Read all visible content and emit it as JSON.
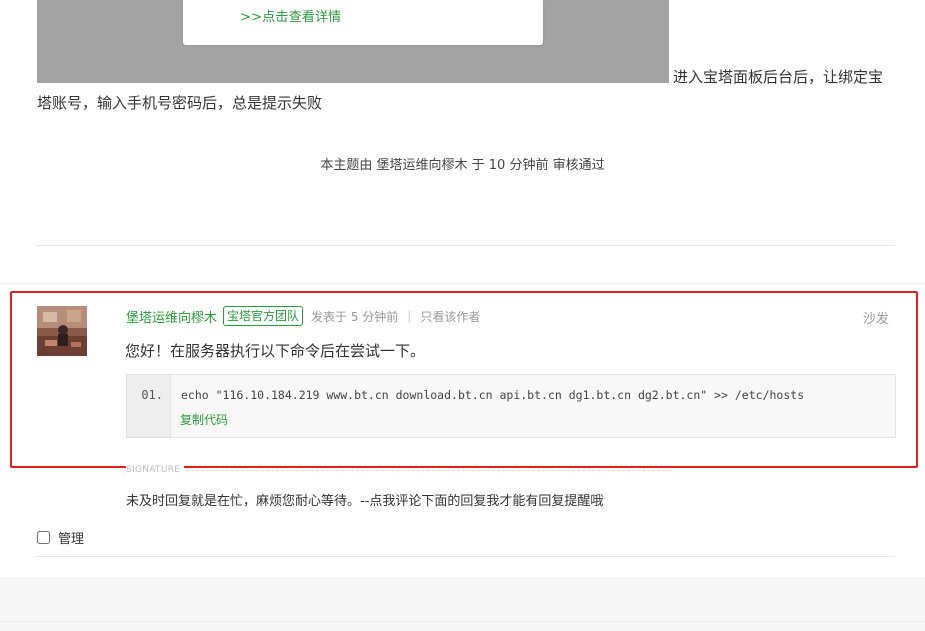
{
  "popup": {
    "detail_link": ">>点击查看详情"
  },
  "post": {
    "text": "进入宝塔面板后台后，让绑定宝塔账号，输入手机号密码后，总是提示失败",
    "review_note": "本主题由 堡塔运维向樛木 于 10 分钟前 审核通过"
  },
  "reply": {
    "author": "堡塔运维向樛木",
    "badge": "宝塔官方团队",
    "posted": "发表于 5 分钟前",
    "separator": "|",
    "only_author": "只看该作者",
    "floor": "沙发",
    "text": "您好！在服务器执行以下命令后在尝试一下。",
    "code": {
      "line_no": "01.",
      "line": "echo \"116.10.184.219 www.bt.cn download.bt.cn api.bt.cn dg1.bt.cn dg2.bt.cn\" >> /etc/hosts",
      "copy_label": "复制代码"
    },
    "signature_label": "SIGNATURE",
    "signature": "未及时回复就是在忙，麻烦您耐心等待。--点我评论下面的回复我才能有回复提醒哦"
  },
  "manage": {
    "label": "管理"
  },
  "colors": {
    "accent": "#2a9b3a",
    "highlight": "#e21f1f"
  }
}
